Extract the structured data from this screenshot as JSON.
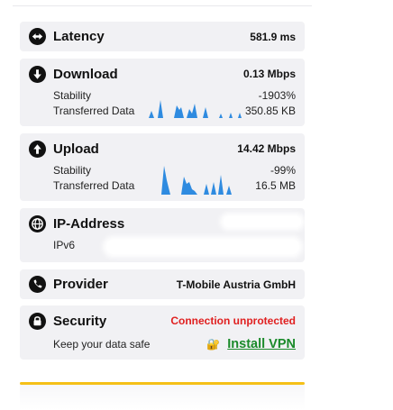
{
  "colors": {
    "card_bg": "#f1f1f4",
    "spark_blue": "#2f8be0",
    "danger": "#e02020",
    "link_green": "#1a8a2a",
    "accent_yellow": "#f5c018"
  },
  "latency": {
    "icon": "left-right-arrows-icon",
    "title": "Latency",
    "value": "581.9 ms"
  },
  "download": {
    "icon": "arrow-down-circle-icon",
    "title": "Download",
    "value": "0.13 Mbps",
    "stability_label": "Stability",
    "stability_value": "-1903%",
    "transferred_label": "Transferred Data",
    "transferred_value": "350.85 KB"
  },
  "upload": {
    "icon": "arrow-up-circle-icon",
    "title": "Upload",
    "value": "14.42 Mbps",
    "stability_label": "Stability",
    "stability_value": "-99%",
    "transferred_label": "Transferred Data",
    "transferred_value": "16.5 MB"
  },
  "ip": {
    "icon": "globe-icon",
    "title": "IP-Address",
    "ipv6_label": "IPv6"
  },
  "provider": {
    "icon": "phone-icon",
    "title": "Provider",
    "value": "T-Mobile Austria GmbH"
  },
  "security": {
    "icon": "lock-icon",
    "title": "Security",
    "status": "Connection unprotected",
    "subtitle": "Keep your data safe",
    "vpn_icon": "padlock-emoji-icon",
    "vpn_label": "Install VPN"
  }
}
